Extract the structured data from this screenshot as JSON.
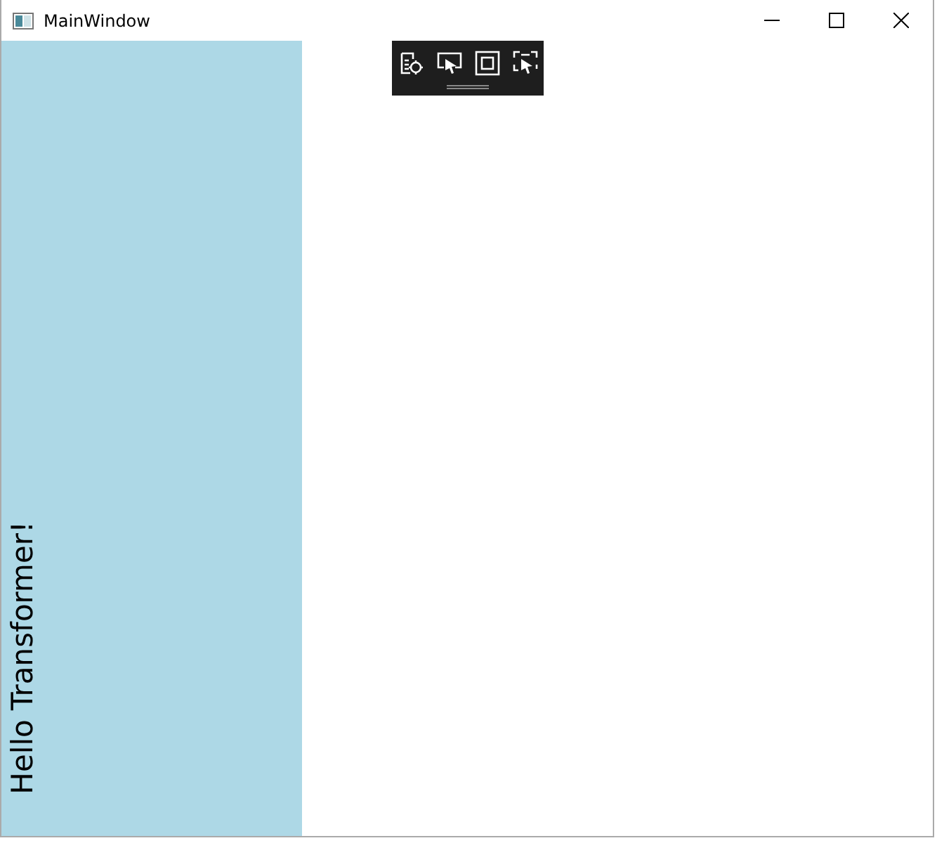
{
  "window": {
    "title": "MainWindow"
  },
  "panel": {
    "text": "Hello Transformer!"
  }
}
